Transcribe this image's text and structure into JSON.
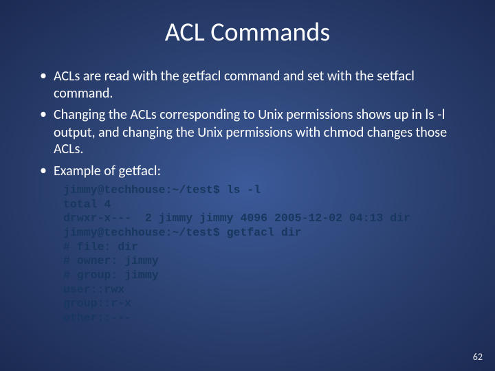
{
  "title": "ACL Commands",
  "bullets": [
    {
      "pre": "ACLs are read with the ",
      "cmd1": "getfacl",
      "mid": " command and set with the ",
      "cmd2": "setfacl",
      "post": " command."
    },
    {
      "pre": "Changing the ACLs corresponding to Unix permissions shows up in ",
      "cmd1": "ls -l",
      "mid": " output, and changing the Unix permissions with ",
      "cmd2": "chmod",
      "post": " changes those ACLs."
    },
    {
      "pre": "Example of ",
      "cmd1": "getfacl",
      "mid": "",
      "cmd2": "",
      "post": ":"
    }
  ],
  "code": "jimmy@techhouse:~/test$ ls -l\ntotal 4\ndrwxr-x---  2 jimmy jimmy 4096 2005-12-02 04:13 dir\njimmy@techhouse:~/test$ getfacl dir\n# file: dir\n# owner: jimmy\n# group: jimmy\nuser::rwx\ngroup::r-x\nother::---",
  "page_number": "62"
}
